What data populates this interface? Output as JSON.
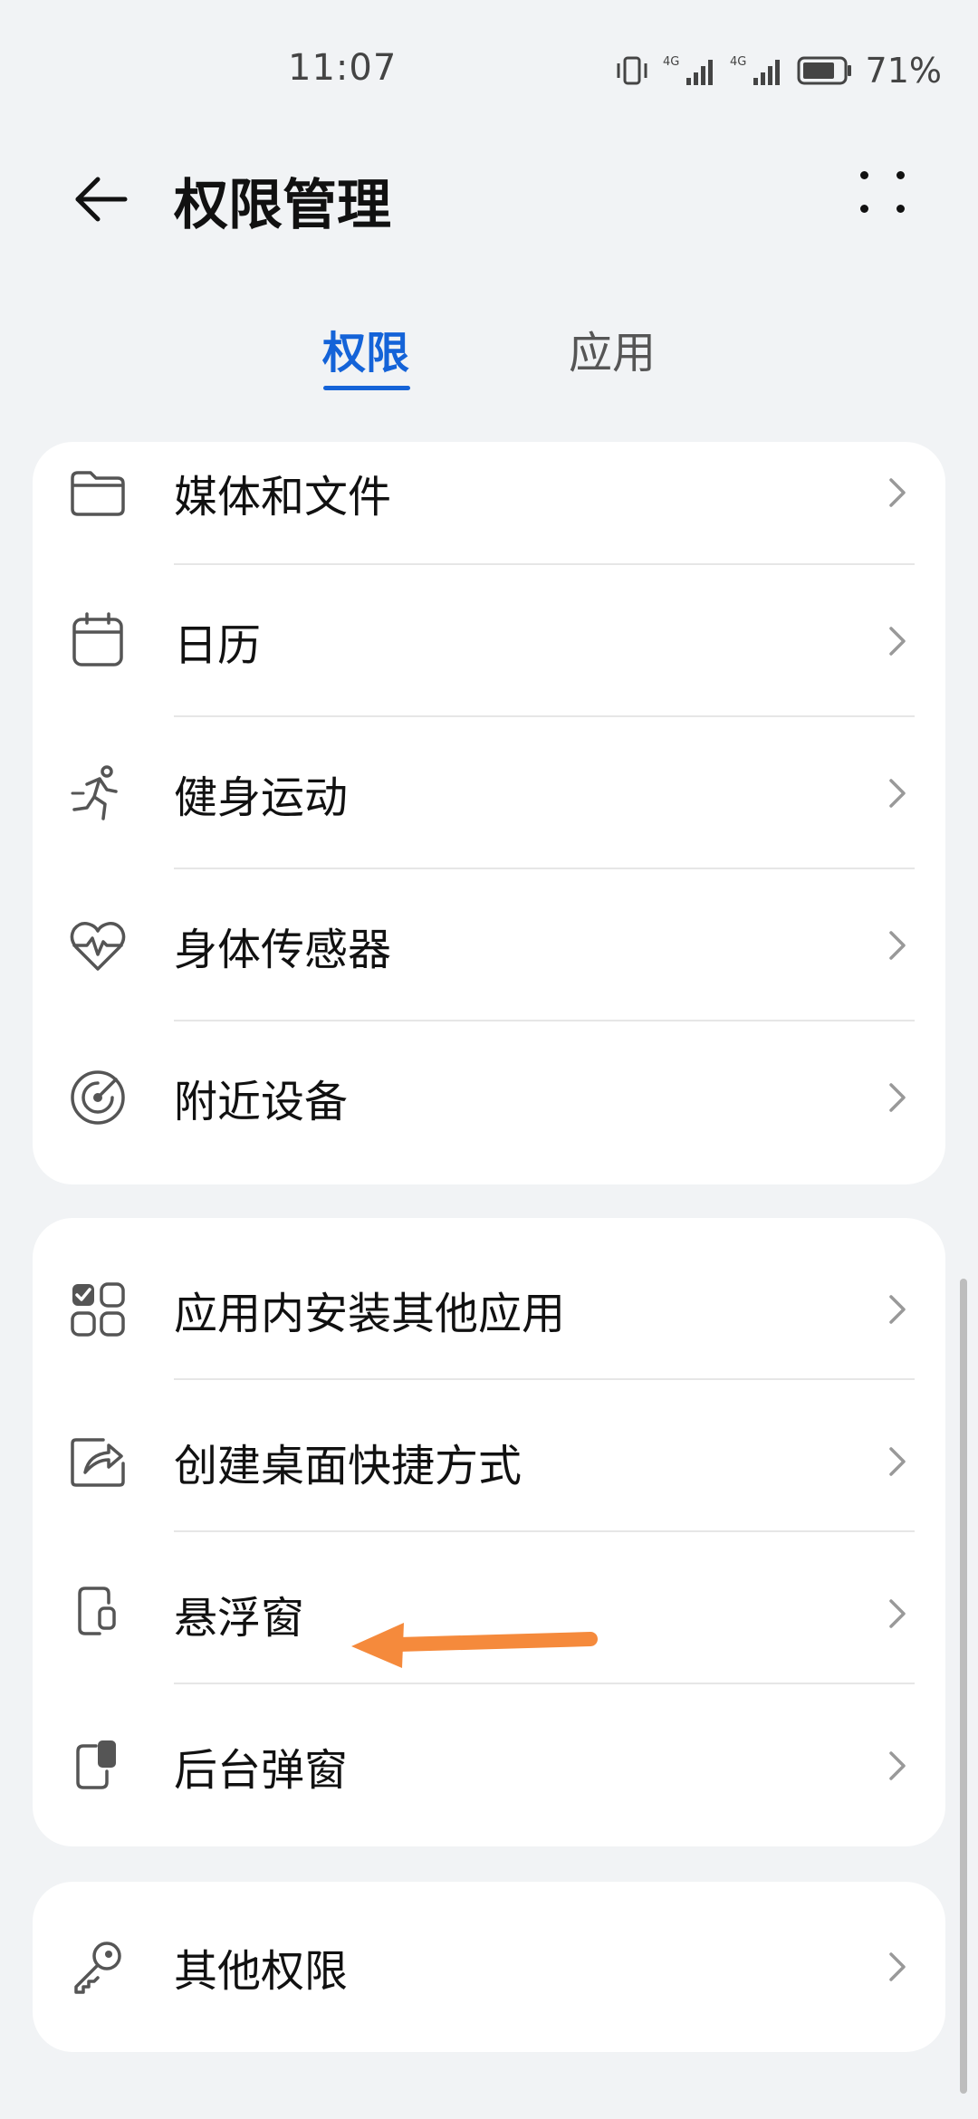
{
  "status_bar": {
    "time": "11:07",
    "signal_1_label": "4G",
    "signal_2_label": "4G",
    "battery_percent": "71%"
  },
  "header": {
    "title": "权限管理",
    "back_icon": "arrow-left-icon",
    "more_icon": "more-grid-icon"
  },
  "tabs": [
    {
      "label": "权限",
      "active": true
    },
    {
      "label": "应用",
      "active": false
    }
  ],
  "groups": [
    {
      "items": [
        {
          "label": "媒体和文件",
          "icon": "folder-icon"
        },
        {
          "label": "日历",
          "icon": "calendar-icon"
        },
        {
          "label": "健身运动",
          "icon": "running-icon"
        },
        {
          "label": "身体传感器",
          "icon": "heart-pulse-icon"
        },
        {
          "label": "附近设备",
          "icon": "radar-icon"
        }
      ]
    },
    {
      "items": [
        {
          "label": "应用内安装其他应用",
          "icon": "apps-check-icon"
        },
        {
          "label": "创建桌面快捷方式",
          "icon": "share-shortcut-icon"
        },
        {
          "label": "悬浮窗",
          "icon": "floating-window-icon"
        },
        {
          "label": "后台弹窗",
          "icon": "background-popup-icon"
        }
      ]
    },
    {
      "items": [
        {
          "label": "其他权限",
          "icon": "key-icon"
        }
      ]
    }
  ],
  "colors": {
    "accent": "#1463d8",
    "background": "#f1f3f5",
    "card": "#ffffff",
    "annotation_arrow": "#f58a3c"
  }
}
